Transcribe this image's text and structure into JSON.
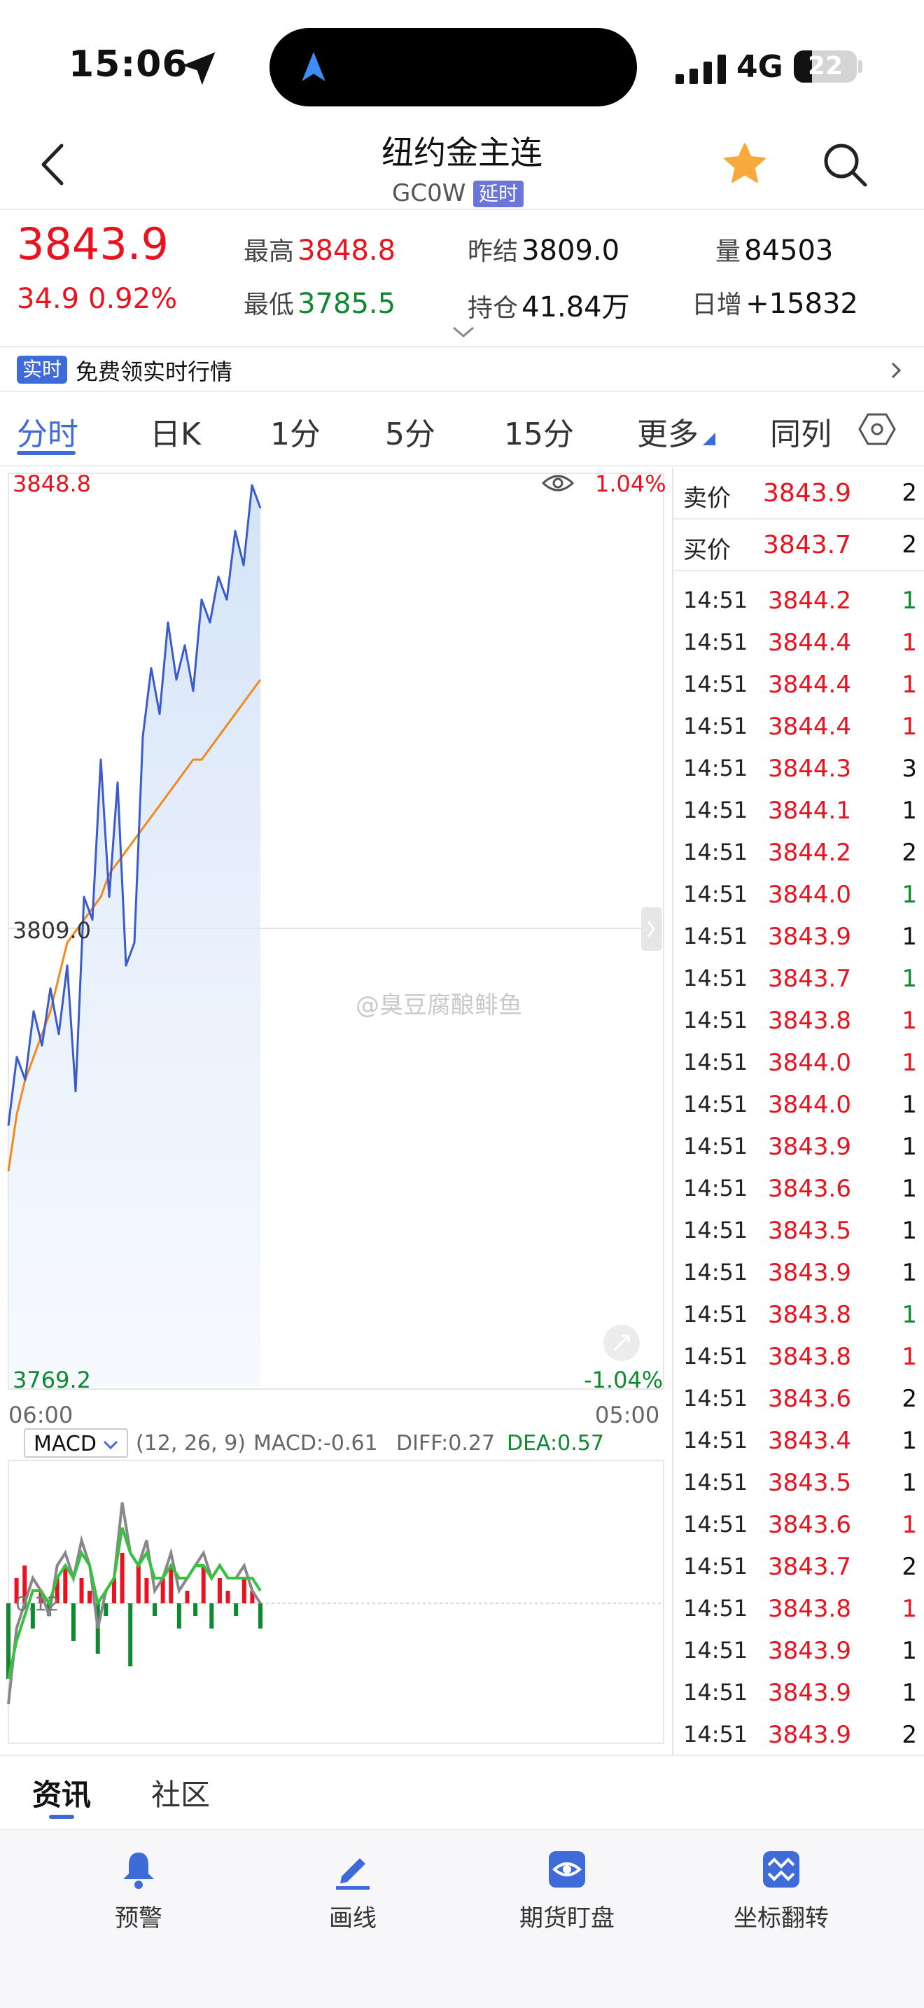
{
  "status_bar": {
    "time": "15:06",
    "network": "4G",
    "battery": "22"
  },
  "header": {
    "title": "纽约金主连",
    "code": "GC0W",
    "badge": "延时"
  },
  "quote": {
    "price": "3843.9",
    "change_abs": "34.9",
    "change_pct": "0.92%",
    "high_label": "最高",
    "high": "3848.8",
    "low_label": "最低",
    "low": "3785.5",
    "prev_close_label": "昨结",
    "prev_close": "3809.0",
    "open_interest_label": "持仓",
    "open_interest": "41.84万",
    "volume_label": "量",
    "volume": "84503",
    "daily_inc_label": "日增",
    "daily_inc": "+15832"
  },
  "banner": {
    "badge": "实时",
    "text": "免费领实时行情"
  },
  "tabs": [
    "分时",
    "日K",
    "1分",
    "5分",
    "15分",
    "更多",
    "同列"
  ],
  "chart": {
    "upper_price": "3848.8",
    "upper_pct": "1.04%",
    "mid_price": "3809.0",
    "lower_price": "3769.2",
    "lower_pct": "-1.04%",
    "time_start": "06:00",
    "time_end": "05:00",
    "mid_value_macd": "0.12"
  },
  "chart_data": {
    "type": "line",
    "title": "",
    "xlabel": "",
    "ylabel": "",
    "x_range": [
      "06:00",
      "05:00"
    ],
    "ylim": [
      3769.2,
      3848.8
    ],
    "reference_line": 3809.0,
    "series": [
      {
        "name": "price",
        "color": "#3b5bcc",
        "values": [
          3792,
          3798,
          3796,
          3802,
          3799,
          3804,
          3800,
          3806,
          3795,
          3812,
          3810,
          3824,
          3812,
          3822,
          3806,
          3808,
          3826,
          3832,
          3828,
          3836,
          3831,
          3834,
          3830,
          3838,
          3836,
          3840,
          3838,
          3844,
          3841,
          3848,
          3846
        ]
      },
      {
        "name": "average",
        "color": "#ef8a1c",
        "values": [
          3788,
          3793,
          3796,
          3798,
          3800,
          3802,
          3805,
          3808,
          3809,
          3810,
          3811,
          3812,
          3814,
          3815,
          3816,
          3817,
          3818,
          3819,
          3820,
          3821,
          3822,
          3823,
          3824,
          3824,
          3825,
          3826,
          3827,
          3828,
          3829,
          3830,
          3831
        ]
      }
    ],
    "macd": {
      "params": "(12, 26, 9)",
      "macd_label": "MACD:",
      "macd": "-0.61",
      "diff_label": "DIFF:",
      "diff": "0.27",
      "dea_label": "DEA:",
      "dea": "0.57",
      "hist": [
        -6,
        2,
        3,
        -2,
        1,
        -1,
        2,
        3,
        -3,
        2,
        1,
        -4,
        -1,
        2,
        4,
        -5,
        3,
        2,
        -1,
        2,
        3,
        -2,
        1,
        -1,
        3,
        -2,
        2,
        1,
        -1,
        2,
        1,
        -2
      ],
      "diff_values": [
        -8,
        -2,
        0,
        2,
        1,
        -1,
        3,
        4,
        2,
        5,
        3,
        -2,
        1,
        2,
        8,
        4,
        3,
        5,
        1,
        2,
        4,
        1,
        2,
        3,
        4,
        2,
        3,
        2,
        2,
        3,
        1,
        0
      ],
      "dea_values": [
        -6,
        -3,
        -1,
        1,
        1,
        0,
        2,
        3,
        2,
        4,
        3,
        0,
        1,
        2,
        6,
        4,
        3,
        4,
        2,
        2,
        3,
        2,
        2,
        3,
        3,
        2,
        3,
        2,
        2,
        2,
        2,
        1
      ]
    }
  },
  "book": [
    {
      "label": "卖价",
      "price": "3843.9",
      "vol": "2"
    },
    {
      "label": "买价",
      "price": "3843.7",
      "vol": "2"
    }
  ],
  "trades": [
    {
      "time": "14:51",
      "price": "3844.2",
      "vol": "1",
      "dir": "green"
    },
    {
      "time": "14:51",
      "price": "3844.4",
      "vol": "1",
      "dir": "red"
    },
    {
      "time": "14:51",
      "price": "3844.4",
      "vol": "1",
      "dir": "red"
    },
    {
      "time": "14:51",
      "price": "3844.4",
      "vol": "1",
      "dir": "red"
    },
    {
      "time": "14:51",
      "price": "3844.3",
      "vol": "3",
      "dir": "black"
    },
    {
      "time": "14:51",
      "price": "3844.1",
      "vol": "1",
      "dir": "black"
    },
    {
      "time": "14:51",
      "price": "3844.2",
      "vol": "2",
      "dir": "black"
    },
    {
      "time": "14:51",
      "price": "3844.0",
      "vol": "1",
      "dir": "green"
    },
    {
      "time": "14:51",
      "price": "3843.9",
      "vol": "1",
      "dir": "black"
    },
    {
      "time": "14:51",
      "price": "3843.7",
      "vol": "1",
      "dir": "green"
    },
    {
      "time": "14:51",
      "price": "3843.8",
      "vol": "1",
      "dir": "red"
    },
    {
      "time": "14:51",
      "price": "3844.0",
      "vol": "1",
      "dir": "red"
    },
    {
      "time": "14:51",
      "price": "3844.0",
      "vol": "1",
      "dir": "black"
    },
    {
      "time": "14:51",
      "price": "3843.9",
      "vol": "1",
      "dir": "black"
    },
    {
      "time": "14:51",
      "price": "3843.6",
      "vol": "1",
      "dir": "black"
    },
    {
      "time": "14:51",
      "price": "3843.5",
      "vol": "1",
      "dir": "black"
    },
    {
      "time": "14:51",
      "price": "3843.9",
      "vol": "1",
      "dir": "black"
    },
    {
      "time": "14:51",
      "price": "3843.8",
      "vol": "1",
      "dir": "green"
    },
    {
      "time": "14:51",
      "price": "3843.8",
      "vol": "1",
      "dir": "red"
    },
    {
      "time": "14:51",
      "price": "3843.6",
      "vol": "2",
      "dir": "black"
    },
    {
      "time": "14:51",
      "price": "3843.4",
      "vol": "1",
      "dir": "black"
    },
    {
      "time": "14:51",
      "price": "3843.5",
      "vol": "1",
      "dir": "black"
    },
    {
      "time": "14:51",
      "price": "3843.6",
      "vol": "1",
      "dir": "red"
    },
    {
      "time": "14:51",
      "price": "3843.7",
      "vol": "2",
      "dir": "black"
    },
    {
      "time": "14:51",
      "price": "3843.8",
      "vol": "1",
      "dir": "red"
    },
    {
      "time": "14:51",
      "price": "3843.9",
      "vol": "1",
      "dir": "black"
    },
    {
      "time": "14:51",
      "price": "3843.9",
      "vol": "1",
      "dir": "black"
    },
    {
      "time": "14:51",
      "price": "3843.9",
      "vol": "2",
      "dir": "black"
    }
  ],
  "watermark": "@臭豆腐酿鲱鱼",
  "bottom_tabs": {
    "news": "资讯",
    "community": "社区"
  },
  "bottom_nav": [
    {
      "label": "预警",
      "icon": "bell-icon"
    },
    {
      "label": "画线",
      "icon": "draw-line-icon"
    },
    {
      "label": "期货盯盘",
      "icon": "eye-watch-icon"
    },
    {
      "label": "坐标翻转",
      "icon": "flip-axis-icon"
    }
  ],
  "colors": {
    "red": "#e8131e",
    "green": "#0d8a2f",
    "accent": "#3e6bd8",
    "price_line": "#3b5bcc",
    "avg_line": "#ef8a1c"
  }
}
